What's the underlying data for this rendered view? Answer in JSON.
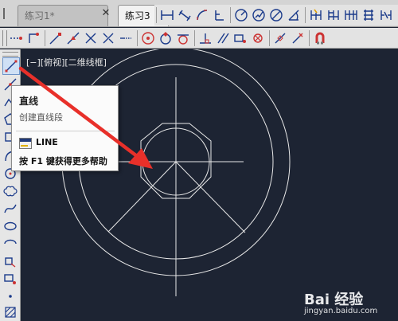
{
  "tabs": [
    {
      "label": "练习1*"
    },
    {
      "label": "练习3"
    }
  ],
  "tab_close": "✕",
  "view_label": "[−][俯视][二维线框]",
  "tooltip": {
    "title": "直线",
    "description": "创建直线段",
    "command": "LINE",
    "help": "按 F1 键获得更多帮助"
  },
  "watermark": {
    "brand": "Bai 经验",
    "url": "jingyan.baidu.com"
  },
  "colors": {
    "canvas": "#1d2433",
    "geometry": "#e8e8e8",
    "arrow": "#e8302a"
  },
  "icons": {
    "toolbar_top": [
      "dimension-linear-icon",
      "dimension-aligned-icon",
      "dimension-arc-icon",
      "dimension-ordinate-icon",
      "dimension-radius-icon",
      "dimension-jogged-icon",
      "dimension-diameter-icon",
      "dimension-angular-icon",
      "quick-dimension-icon",
      "dimension-baseline-icon",
      "dimension-continue-icon",
      "dimension-space-icon"
    ],
    "toolbar_2": [
      "snap-temp-track-icon",
      "snap-from-icon",
      "snap-endpoint-icon",
      "snap-midpoint-icon",
      "snap-intersection-icon",
      "snap-apparent-intersection-icon",
      "snap-extension-icon",
      "snap-center-icon",
      "snap-quadrant-icon",
      "snap-tangent-icon",
      "snap-perpendicular-icon",
      "snap-parallel-icon",
      "snap-insert-icon",
      "snap-node-icon",
      "snap-nearest-icon",
      "snap-none-icon",
      "snap-settings-icon"
    ],
    "toolbar_left": [
      "line-icon",
      "construction-line-icon",
      "polyline-icon",
      "polygon-icon",
      "rectangle-icon",
      "arc-icon",
      "circle-icon",
      "revision-cloud-icon",
      "spline-icon",
      "ellipse-icon",
      "ellipse-arc-icon",
      "insert-block-icon",
      "make-block-icon",
      "point-icon",
      "hatch-icon"
    ]
  }
}
